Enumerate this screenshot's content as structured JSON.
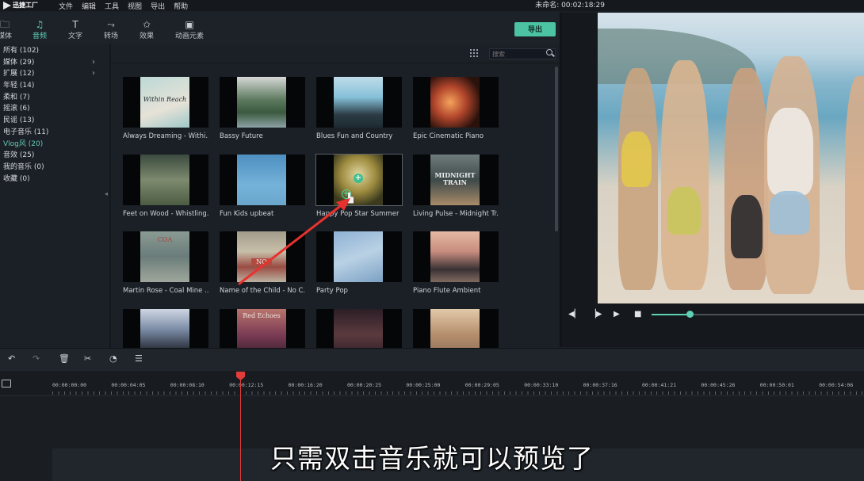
{
  "app": {
    "logo_text": "迅捷工厂",
    "menu": [
      "文件",
      "编辑",
      "工具",
      "视图",
      "导出",
      "帮助"
    ],
    "project_title": "未命名: 00:02:18:29"
  },
  "tabs": [
    {
      "label": "媒体",
      "icon": "folder-icon",
      "glyph": "🗀"
    },
    {
      "label": "音频",
      "icon": "music-note-icon",
      "glyph": "♫"
    },
    {
      "label": "文字",
      "icon": "text-icon",
      "glyph": "T"
    },
    {
      "label": "转场",
      "icon": "transition-icon",
      "glyph": "⤳"
    },
    {
      "label": "效果",
      "icon": "effects-icon",
      "glyph": "✩"
    },
    {
      "label": "动画元素",
      "icon": "image-icon",
      "glyph": "▣"
    }
  ],
  "export_label": "导出",
  "categories": [
    {
      "label": "所有 (102)",
      "chevron": false
    },
    {
      "label": "媒体 (29)",
      "chevron": true
    },
    {
      "label": "扩展 (12)",
      "chevron": true
    },
    {
      "label": "年轻 (14)",
      "chevron": false
    },
    {
      "label": "柔和 (7)",
      "chevron": false
    },
    {
      "label": "摇滚 (6)",
      "chevron": false
    },
    {
      "label": "民谣 (13)",
      "chevron": false
    },
    {
      "label": "电子音乐 (11)",
      "chevron": false
    },
    {
      "label": "Vlog风 (20)",
      "chevron": false,
      "active": true
    },
    {
      "label": "音效 (25)",
      "chevron": false
    },
    {
      "label": "我的音乐 (0)",
      "chevron": false
    },
    {
      "label": "收藏 (0)",
      "chevron": false
    }
  ],
  "search": {
    "placeholder": "搜索"
  },
  "library": [
    {
      "label": "Always Dreaming - Withi...",
      "art_text": "Within Reach"
    },
    {
      "label": "Bassy Future",
      "art_text": ""
    },
    {
      "label": "Blues Fun and Country",
      "art_text": ""
    },
    {
      "label": "Epic Cinematic Piano",
      "art_text": ""
    },
    {
      "label": "Feet on Wood - Whistling...",
      "art_text": ""
    },
    {
      "label": "Fun Kids upbeat",
      "art_text": ""
    },
    {
      "label": "Happy Pop Star Summer ...",
      "art_text": "",
      "selected": true
    },
    {
      "label": "Living Pulse - Midnight Tr...",
      "art_text": "MIDNIGHT TRAIN"
    },
    {
      "label": "Martin Rose - Coal Mine ...",
      "art_text": "COA"
    },
    {
      "label": "Name of the Child - No C...",
      "art_text": "NO"
    },
    {
      "label": "Party Pop",
      "art_text": ""
    },
    {
      "label": "Piano Flute Ambient",
      "art_text": ""
    },
    {
      "label": "",
      "art_text": ""
    },
    {
      "label": "",
      "art_text": "Red Echoes"
    },
    {
      "label": "",
      "art_text": ""
    },
    {
      "label": "",
      "art_text": ""
    }
  ],
  "playback": {
    "progress": 0.18
  },
  "ruler_labels": [
    "00:00:00:00",
    "00:00:04:05",
    "00:00:08:10",
    "00:00:12:15",
    "00:00:16:20",
    "00:00:20:25",
    "00:00:25:00",
    "00:00:29:05",
    "00:00:33:10",
    "00:00:37:16",
    "00:00:41:21",
    "00:00:45:26",
    "00:00:50:01",
    "00:00:54:06"
  ],
  "caption": "只需双击音乐就可以预览了",
  "colors": {
    "accent": "#5ed1b4",
    "playhead": "#e23b3b",
    "annotation": "#e8322f"
  }
}
